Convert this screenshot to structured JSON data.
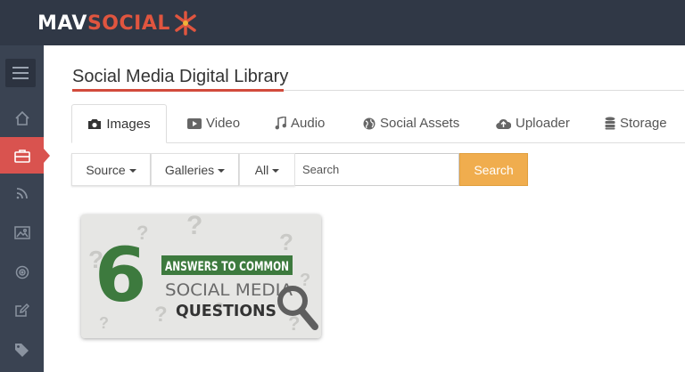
{
  "app": {
    "logo_part1": "MAV",
    "logo_part2": "SOCIAL",
    "trademark": "®"
  },
  "colors": {
    "topbar": "#303846",
    "sidebar": "#3a4352",
    "accent_red": "#d24b3c",
    "search_orange": "#f0ad4e",
    "thumb_green": "#3d7a3e"
  },
  "sidebar": {
    "items": [
      {
        "icon": "menu-icon"
      },
      {
        "icon": "home-icon"
      },
      {
        "icon": "briefcase-icon",
        "active": true
      },
      {
        "icon": "rss-icon"
      },
      {
        "icon": "image-icon"
      },
      {
        "icon": "target-icon"
      },
      {
        "icon": "edit-icon"
      },
      {
        "icon": "tag-icon"
      }
    ]
  },
  "page": {
    "title": "Social Media Digital Library"
  },
  "tabs": [
    {
      "label": "Images",
      "icon": "camera-icon",
      "active": true
    },
    {
      "label": "Video",
      "icon": "video-icon"
    },
    {
      "label": "Audio",
      "icon": "music-icon"
    },
    {
      "label": "Social Assets",
      "icon": "globe-icon"
    },
    {
      "label": "Uploader",
      "icon": "cloud-upload-icon"
    },
    {
      "label": "Storage",
      "icon": "database-icon"
    }
  ],
  "filters": {
    "source_label": "Source",
    "galleries_label": "Galleries",
    "all_label": "All",
    "search_placeholder": "Search",
    "search_button": "Search"
  },
  "library": {
    "items": [
      {
        "big_number": "6",
        "line1": "ANSWERS TO COMMON",
        "line2": "SOCIAL MEDIA",
        "line3": "QUESTIONS"
      }
    ]
  }
}
